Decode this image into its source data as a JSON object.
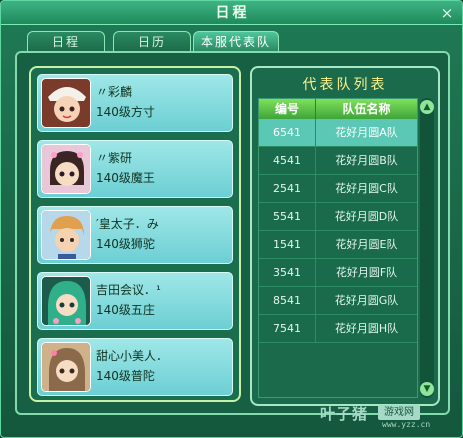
{
  "window": {
    "title": "日程",
    "close_label": "×"
  },
  "tabs": [
    {
      "label": "日程",
      "active": false
    },
    {
      "label": "日历",
      "active": false
    },
    {
      "label": "本服代表队",
      "active": true
    }
  ],
  "players": [
    {
      "name": "〃彩麟",
      "level": "140级方寸",
      "avatar": "avatar-girl-white-hat",
      "color": "#c87a4a"
    },
    {
      "name": "〃紫研",
      "level": "140级魔王",
      "avatar": "avatar-girl-flowers",
      "color": "#4a2e2e"
    },
    {
      "name": "′皇太子．み",
      "level": "140级狮驼",
      "avatar": "avatar-boy-blond",
      "color": "#d99a4e"
    },
    {
      "name": "吉田会议．¹",
      "level": "140级五庄",
      "avatar": "avatar-girl-green-hair",
      "color": "#2fb08a"
    },
    {
      "name": "甜心小美人．",
      "level": "140级普陀",
      "avatar": "avatar-girl-brown-hair",
      "color": "#8a6a4a"
    }
  ],
  "team_list": {
    "title": "代表队列表",
    "headers": {
      "id": "编号",
      "name": "队伍名称"
    },
    "rows": [
      {
        "id": "6541",
        "name": "花好月圆A队",
        "selected": true
      },
      {
        "id": "4541",
        "name": "花好月圆B队",
        "selected": false
      },
      {
        "id": "2541",
        "name": "花好月圆C队",
        "selected": false
      },
      {
        "id": "5541",
        "name": "花好月圆D队",
        "selected": false
      },
      {
        "id": "1541",
        "name": "花好月圆E队",
        "selected": false
      },
      {
        "id": "3541",
        "name": "花好月圆F队",
        "selected": false
      },
      {
        "id": "8541",
        "name": "花好月圆G队",
        "selected": false
      },
      {
        "id": "7541",
        "name": "花好月圆H队",
        "selected": false
      }
    ]
  },
  "watermark": {
    "main": "叶子猪",
    "tag": "游戏网",
    "url": "www.yzz.cn"
  }
}
